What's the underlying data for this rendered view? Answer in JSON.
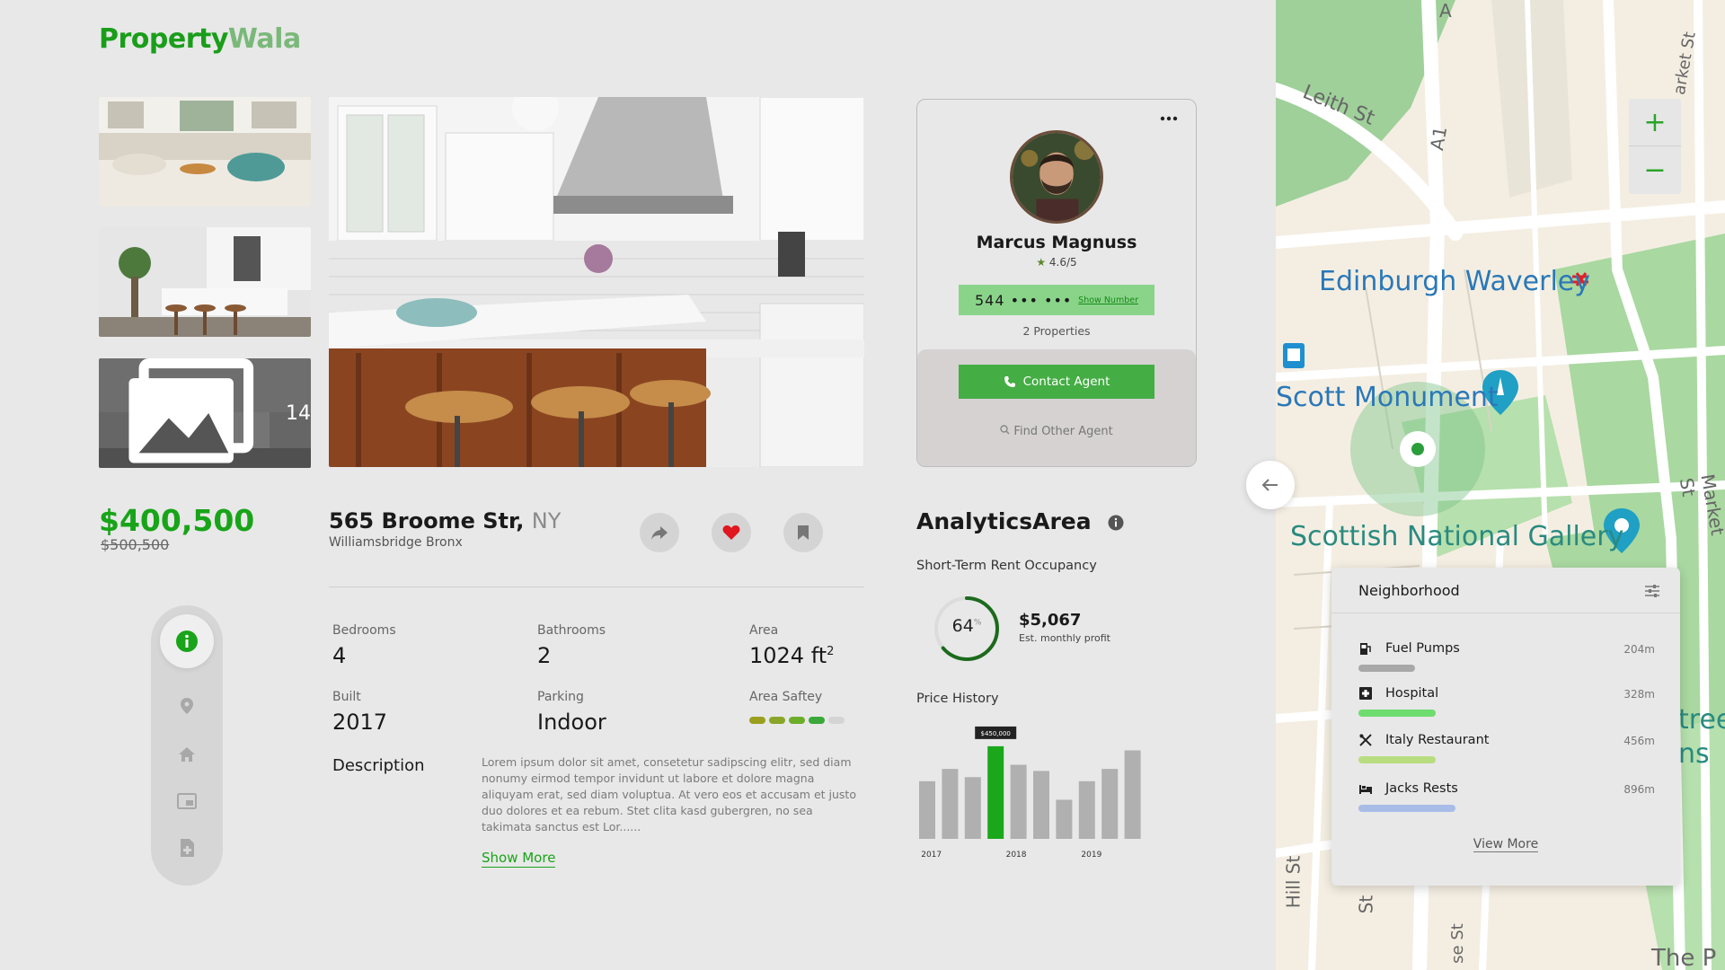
{
  "brand": {
    "part1": "Property",
    "part2": "Wala"
  },
  "gallery": {
    "more_count": "14"
  },
  "listing": {
    "price": "$400,500",
    "old_price": "$500,500",
    "address": "565 Broome Str,",
    "city": "NY",
    "neighborhood": "Williamsbridge Bronx"
  },
  "details": {
    "bedrooms_label": "Bedrooms",
    "bedrooms": "4",
    "bathrooms_label": "Bathrooms",
    "bathrooms": "2",
    "area_label": "Area",
    "area": "1024 ft",
    "area_unit_sup": "2",
    "built_label": "Built",
    "built": "2017",
    "parking_label": "Parking",
    "parking": "Indoor",
    "safety_label": "Area Saftey",
    "safety_level": 4,
    "safety_max": 5
  },
  "description": {
    "title": "Description",
    "text": "Lorem ipsum dolor sit amet, consetetur sadipscing elitr, sed diam nonumy eirmod tempor invidunt ut labore et dolore magna aliquyam erat, sed diam voluptua. At vero eos et accusam et justo duo dolores et ea rebum. Stet clita kasd gubergren, no sea takimata sanctus est Lor......",
    "show_more": "Show More"
  },
  "agent": {
    "name": "Marcus Magnuss",
    "rating": "4.6/5",
    "phone": "544 ••• •••",
    "show_number": "Show Number",
    "properties": "2 Properties",
    "contact": "Contact Agent",
    "find_other": "Find Other Agent"
  },
  "analytics": {
    "title": "AnalyticsArea",
    "occupancy_title": "Short-Term Rent Occupancy",
    "occupancy_percent": 64,
    "occupancy_text": "64",
    "percent_sign": "%",
    "profit": "$5,067",
    "profit_label": "Est. monthly profit",
    "price_history_title": "Price History"
  },
  "chart_data": {
    "type": "bar",
    "title": "Price History",
    "x_tick_labels": [
      "2017",
      "2018",
      "2019"
    ],
    "highlighted_label": "$450,000",
    "highlighted_index": 3,
    "values": [
      280000,
      340000,
      300000,
      450000,
      360000,
      330000,
      190000,
      280000,
      340000,
      430000
    ],
    "ylim": [
      0,
      480000
    ],
    "colors": {
      "bar": "#b0b0b0",
      "highlight": "#1aa81a"
    }
  },
  "map": {
    "labels": {
      "leith": "Leith St",
      "a1": "A1",
      "waverley": "Edinburgh Waverley",
      "scott": "Scott Monument",
      "gallery": "Scottish National Gallery",
      "market": "Market St",
      "market_top": "arket St",
      "street_right": "tree",
      "street_right2": "ns",
      "hill": "Hill St",
      "st_bottom": "St",
      "se_st": "se St",
      "the": "The P",
      "a_top": "A"
    },
    "zoom_in": "+",
    "zoom_out": "−"
  },
  "neighborhood": {
    "title": "Neighborhood",
    "items": [
      {
        "name": "Fuel Pumps",
        "distance": "204m",
        "color": "#a8a8a8",
        "score": 0.33
      },
      {
        "name": "Hospital",
        "distance": "328m",
        "color": "#6fdc6f",
        "score": 0.45
      },
      {
        "name": "Italy Restaurant",
        "distance": "456m",
        "color": "#b8dd80",
        "score": 0.45
      },
      {
        "name": "Jacks Rests",
        "distance": "896m",
        "color": "#a8bce8",
        "score": 0.57
      }
    ],
    "view_more": "View More"
  }
}
